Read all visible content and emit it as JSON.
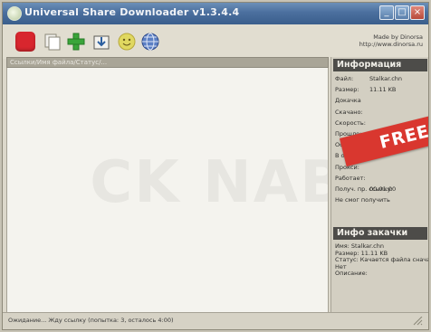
{
  "window": {
    "title": "Universal Share Downloader v1.3.4.4",
    "controls": {
      "minimize": "_",
      "maximize": "□",
      "close": "×"
    }
  },
  "toolbar": {
    "buttons": [
      {
        "name": "stop-icon",
        "color": "#d8262e"
      },
      {
        "name": "copy-icon"
      },
      {
        "name": "add-icon",
        "color": "#3aa53a"
      },
      {
        "name": "download-icon"
      },
      {
        "name": "smiley-icon",
        "color": "#e0d860"
      },
      {
        "name": "globe-icon",
        "color": "#3d5da8"
      }
    ],
    "made_by": "Made by Dinorsa",
    "url": "http://www.dinorsa.ru"
  },
  "list": {
    "header": "Ссылки/Имя файла/Статус/..."
  },
  "info_panel": {
    "title": "Информация",
    "rows": [
      {
        "label": "Файл:",
        "value": "Stalkar.chn"
      },
      {
        "label": "Размер:",
        "value": "11.11 KB"
      },
      {
        "label": "Докачка",
        "value": ""
      },
      {
        "label": "Скачано:",
        "value": ""
      },
      {
        "label": "Скорость:",
        "value": ""
      },
      {
        "label": "Прошло:",
        "value": ""
      },
      {
        "label": "Осталось:",
        "value": ""
      },
      {
        "label": "В очереди:",
        "value": ""
      },
      {
        "label": "Прокси:",
        "value": ""
      },
      {
        "label": "Работает:",
        "value": ""
      },
      {
        "label": "Получ. пр. ссылку:",
        "value": "00:01:00"
      },
      {
        "label": "Не смог получить",
        "value": ""
      }
    ]
  },
  "download_panel": {
    "title": "Инфо закачки",
    "rows": [
      "Имя: Stalkar.chn",
      "Размер: 11.11 KB",
      "Статус: Качается файла сначала",
      "Нет",
      "Описание:"
    ]
  },
  "banner": {
    "text": "FREE",
    "color": "#d9372f"
  },
  "status": {
    "text": "Ожидание... Жду ссылку (попытка: 3, осталось 4:00)"
  }
}
